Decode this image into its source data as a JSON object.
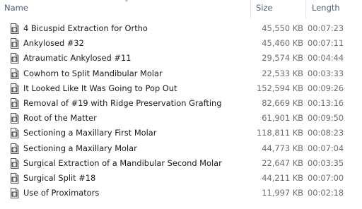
{
  "columns": {
    "name": "Name",
    "size": "Size",
    "length": "Length"
  },
  "files": [
    {
      "name": "4 Bicuspid Extraction for Ortho",
      "size": "45,550 KB",
      "length": "00:07:23",
      "icon": "video-file-icon"
    },
    {
      "name": "Ankylosed #32",
      "size": "45,460 KB",
      "length": "00:07:11",
      "icon": "video-file-icon"
    },
    {
      "name": "Atraumatic Ankylosed #11",
      "size": "29,574 KB",
      "length": "00:04:44",
      "icon": "video-file-icon"
    },
    {
      "name": "Cowhorn to Split Mandibular Molar",
      "size": "22,533 KB",
      "length": "00:03:33",
      "icon": "video-file-icon"
    },
    {
      "name": "It Looked Like It Was Going to Pop Out",
      "size": "152,594 KB",
      "length": "00:09:26",
      "icon": "video-file-icon"
    },
    {
      "name": "Removal of #19 with Ridge Preservation Grafting",
      "size": "82,669 KB",
      "length": "00:13:16",
      "icon": "video-file-icon"
    },
    {
      "name": "Root of the Matter",
      "size": "61,901 KB",
      "length": "00:09:50",
      "icon": "video-file-icon"
    },
    {
      "name": "Sectioning a Maxillary First Molar",
      "size": "118,811 KB",
      "length": "00:08:23",
      "icon": "video-file-icon"
    },
    {
      "name": "Sectioning a Maxillary Molar",
      "size": "44,773 KB",
      "length": "00:07:04",
      "icon": "video-file-icon"
    },
    {
      "name": "Surgical Extraction of a Mandibular Second Molar",
      "size": "22,647 KB",
      "length": "00:03:35",
      "icon": "video-file-icon"
    },
    {
      "name": "Surgical Split #18",
      "size": "44,211 KB",
      "length": "00:07:00",
      "icon": "video-file-icon"
    },
    {
      "name": "Use of Proximators",
      "size": "11,997 KB",
      "length": "00:02:18",
      "icon": "video-file-icon"
    }
  ],
  "colors": {
    "header_text": "#4c607a",
    "name_text": "#1a1a1a",
    "detail_text": "#6d6d6d"
  }
}
